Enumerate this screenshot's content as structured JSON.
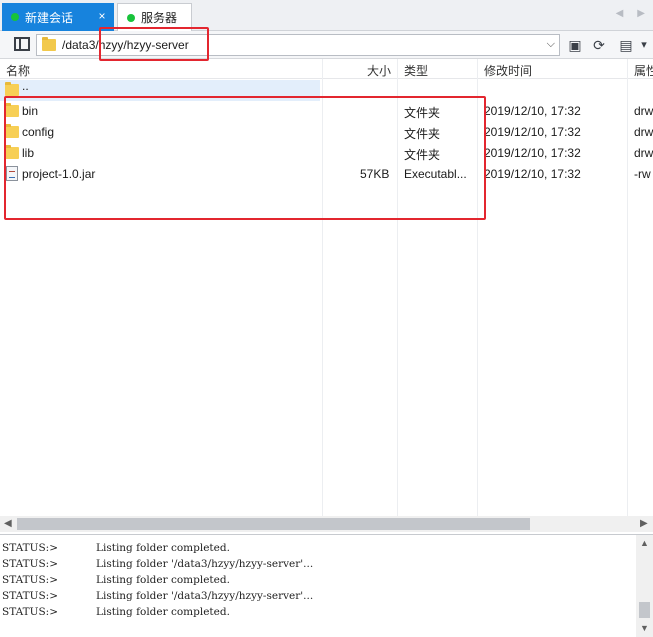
{
  "tabs": [
    {
      "label": "新建会话",
      "close": "×"
    },
    {
      "label": "服务器"
    }
  ],
  "tab_nav": {
    "prev": "◀",
    "next": "▶"
  },
  "address": {
    "path": "/data3/hzyy/hzyy-server",
    "dropdown": "⌵"
  },
  "toolbar": {
    "new_folder": "▣",
    "refresh": "⟳",
    "view": "▤",
    "view_drop": "▾"
  },
  "columns": {
    "name": "名称",
    "size": "大小",
    "type": "类型",
    "modified": "修改时间",
    "attributes": "属性"
  },
  "files": [
    {
      "name": "..",
      "size": "",
      "type": "",
      "modified": "",
      "attr": "",
      "icon": "folder-icon"
    },
    {
      "name": "bin",
      "size": "",
      "type": "文件夹",
      "modified": "2019/12/10, 17:32",
      "attr": "drw",
      "icon": "folder-icon"
    },
    {
      "name": "config",
      "size": "",
      "type": "文件夹",
      "modified": "2019/12/10, 17:32",
      "attr": "drw",
      "icon": "folder-icon"
    },
    {
      "name": "lib",
      "size": "",
      "type": "文件夹",
      "modified": "2019/12/10, 17:32",
      "attr": "drw",
      "icon": "folder-icon"
    },
    {
      "name": "project-1.0.jar",
      "size": "57KB",
      "type": "Executabl...",
      "modified": "2019/12/10, 17:32",
      "attr": "-rw",
      "icon": "jar-file-icon"
    }
  ],
  "scroll_arrows": {
    "left": "◀",
    "right": "▶",
    "up": "▲",
    "down": "▼"
  },
  "log": [
    {
      "label": "STATUS:>",
      "message": "Listing folder completed."
    },
    {
      "label": "STATUS:>",
      "message": "Listing folder '/data3/hzyy/hzyy-server'..."
    },
    {
      "label": "STATUS:>",
      "message": "Listing folder completed."
    },
    {
      "label": "STATUS:>",
      "message": "Listing folder '/data3/hzyy/hzyy-server'..."
    },
    {
      "label": "STATUS:>",
      "message": "Listing folder completed."
    }
  ],
  "colors": {
    "active_tab": "#1783dd",
    "status_dot": "#18c33b",
    "highlight_box": "#e3262f",
    "folder": "#f7cf55"
  }
}
